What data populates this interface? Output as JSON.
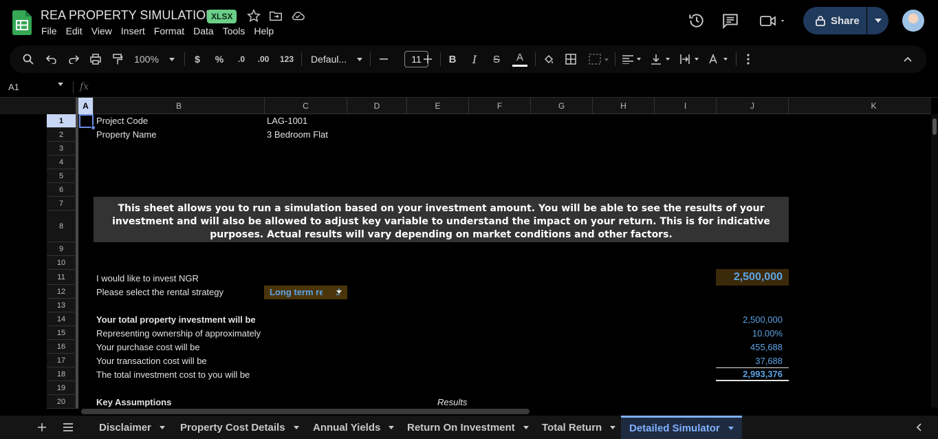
{
  "header": {
    "title": "REA PROPERTY SIMULATION",
    "badge": "XLSX",
    "menu": [
      "File",
      "Edit",
      "View",
      "Insert",
      "Format",
      "Data",
      "Tools",
      "Help"
    ],
    "share_label": "Share"
  },
  "toolbar": {
    "zoom": "100%",
    "currency": "$",
    "percent": "%",
    "decrease_decimal": ".0",
    "increase_decimal": ".00",
    "number_format": "123",
    "font": "Defaul...",
    "font_size": "11",
    "bold": "B",
    "italic": "I",
    "strike": "S",
    "text_color": "A"
  },
  "formula_bar": {
    "name_box": "A1",
    "fx": "fx"
  },
  "grid": {
    "columns": [
      "A",
      "B",
      "C",
      "D",
      "E",
      "F",
      "G",
      "H",
      "I",
      "J",
      "K"
    ],
    "rows": [
      "1",
      "2",
      "3",
      "4",
      "5",
      "6",
      "7",
      "8",
      "9",
      "10",
      "11",
      "12",
      "13",
      "14",
      "15",
      "16",
      "17",
      "18",
      "19",
      "20"
    ],
    "project_code_label": "Project Code",
    "project_code_value": "LAG-1001",
    "property_name_label": "Property Name",
    "property_name_value": "3 Bedroom Flat",
    "notice": "This sheet allows you to run a simulation based on your investment amount. You will be able to see the results of your investment and will also be allowed to adjust key variable to understand the impact on your return. This is for indicative purposes. Actual results will vary depending on market conditions and other factors.",
    "invest_label": "I would like to invest NGR",
    "invest_value": "2,500,000",
    "strategy_label": "Please select the rental strategy",
    "strategy_value": "Long term rental",
    "total_investment_label": "Your total property investment will be",
    "total_investment_value": "2,500,000",
    "ownership_label": "Representing ownership of approximately",
    "ownership_value": "10.00%",
    "purchase_cost_label": "Your purchase cost will be",
    "purchase_cost_value": "455,688",
    "transaction_cost_label": "Your transaction cost will be",
    "transaction_cost_value": "37,688",
    "total_cost_label": "The total investment cost to you will be",
    "total_cost_value": "2,993,376",
    "key_assumptions": "Key Assumptions",
    "results": "Results"
  },
  "tabs": [
    "Disclaimer",
    "Property Cost Details",
    "Annual Yields",
    "Return On Investment",
    "Total Return",
    "Detailed Simulator"
  ],
  "colors": {
    "accent": "#7fb0ff",
    "value_blue": "#5ea3e6",
    "xlsx_green": "#6ccf89",
    "share_bg": "#1f3a5c"
  }
}
